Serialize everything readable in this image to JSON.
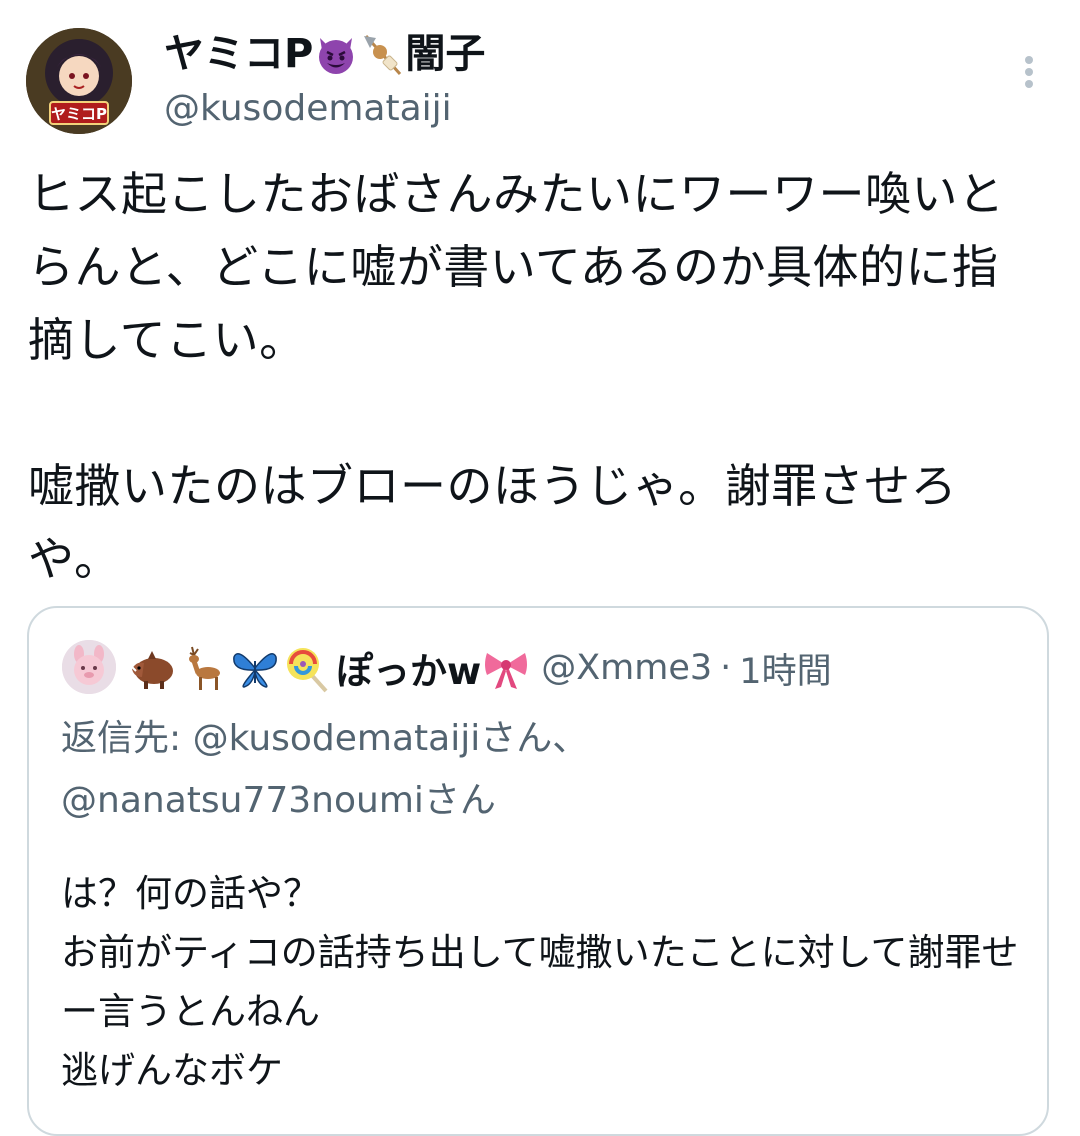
{
  "tweet": {
    "display_name_prefix": "ヤミコP",
    "display_name_suffix": "闇子",
    "display_name_emojis": [
      "smiling-imp-emoji",
      "oden-emoji"
    ],
    "handle": "@kusodemataiji",
    "avatar_badge": "ヤミコP",
    "text": "ヒス起こしたおばさんみたいにワーワー喚いとらんと、どこに嘘が書いてあるのか具体的に指摘してこい。\n\n嘘撒いたのはブローのほうじゃ。謝罪させろや。"
  },
  "quoted_tweet": {
    "emojis_before_name": [
      "boar-emoji",
      "deer-emoji",
      "butterfly-emoji",
      "lollipop-emoji"
    ],
    "display_name": "ぽっかw",
    "emoji_after_name": "ribbon-emoji",
    "handle": "@Xmme3",
    "separator": "·",
    "time": "1時間",
    "replying_to_line1": "返信先: @kusodemataijiさん、",
    "replying_to_line2": "@nanatsu773noumiさん",
    "text": "は？何の話や？\nお前がティコの話持ち出して嘘撒いたことに対して謝罪せー言うとんねん\n逃げんなボケ"
  },
  "colors": {
    "text": "#0f1419",
    "secondary": "#536471",
    "border": "#cfd9de",
    "imp_purple": "#8e44ad"
  }
}
